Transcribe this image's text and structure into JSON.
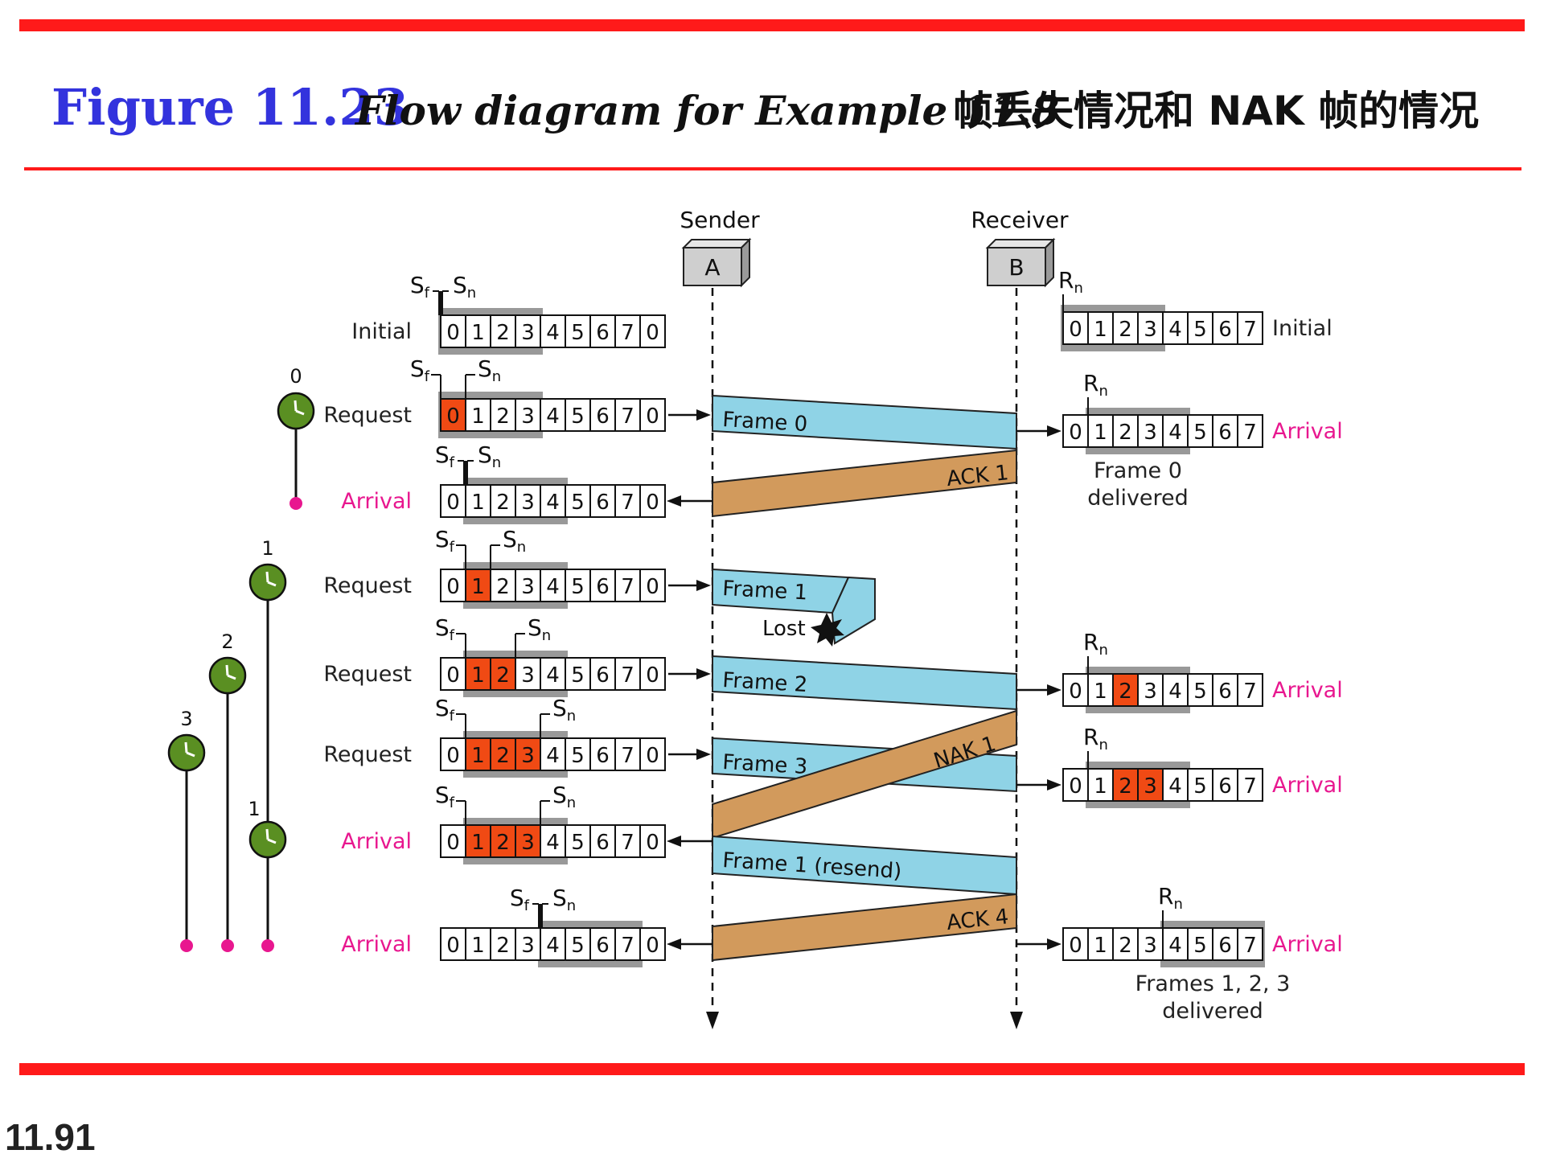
{
  "title": {
    "figure": "Figure 11.23",
    "subtitle": "Flow diagram for Example 11.8",
    "chinese": "帧丢失情况和 NAK 帧的情况"
  },
  "page_number": "11.91",
  "nodes": {
    "sender_label": "Sender",
    "sender_box": "A",
    "receiver_label": "Receiver",
    "receiver_box": "B"
  },
  "colors": {
    "rule": "#ff1a1a",
    "frame": "#8fd3e6",
    "ack": "#d29a5c",
    "highlight": "#f04a14",
    "window": "#999999",
    "timer": "#5a8f22",
    "pink": "#e8178f"
  },
  "var_labels": {
    "sf": "S",
    "sf_sub": "f",
    "sn": "S",
    "sn_sub": "n",
    "rn": "R",
    "rn_sub": "n"
  },
  "sender_rows": [
    {
      "label": "Initial",
      "label_kind": "event",
      "cells": [
        "0",
        "1",
        "2",
        "3",
        "4",
        "5",
        "6",
        "7",
        "0"
      ],
      "highlight": [],
      "window_start": 0,
      "sf": 0,
      "sn": 0
    },
    {
      "label": "Request",
      "label_kind": "event",
      "cells": [
        "0",
        "1",
        "2",
        "3",
        "4",
        "5",
        "6",
        "7",
        "0"
      ],
      "highlight": [
        0
      ],
      "window_start": 0,
      "sf": 0,
      "sn": 1
    },
    {
      "label": "Arrival",
      "label_kind": "arrival",
      "cells": [
        "0",
        "1",
        "2",
        "3",
        "4",
        "5",
        "6",
        "7",
        "0"
      ],
      "highlight": [],
      "window_start": 1,
      "sf": 1,
      "sn": 1
    },
    {
      "label": "Request",
      "label_kind": "event",
      "cells": [
        "0",
        "1",
        "2",
        "3",
        "4",
        "5",
        "6",
        "7",
        "0"
      ],
      "highlight": [
        1
      ],
      "window_start": 1,
      "sf": 1,
      "sn": 2
    },
    {
      "label": "Request",
      "label_kind": "event",
      "cells": [
        "0",
        "1",
        "2",
        "3",
        "4",
        "5",
        "6",
        "7",
        "0"
      ],
      "highlight": [
        1,
        2
      ],
      "window_start": 1,
      "sf": 1,
      "sn": 3
    },
    {
      "label": "Request",
      "label_kind": "event",
      "cells": [
        "0",
        "1",
        "2",
        "3",
        "4",
        "5",
        "6",
        "7",
        "0"
      ],
      "highlight": [
        1,
        2,
        3
      ],
      "window_start": 1,
      "sf": 1,
      "sn": 4
    },
    {
      "label": "Arrival",
      "label_kind": "arrival",
      "cells": [
        "0",
        "1",
        "2",
        "3",
        "4",
        "5",
        "6",
        "7",
        "0"
      ],
      "highlight": [
        1,
        2,
        3
      ],
      "window_start": 1,
      "sf": 1,
      "sn": 4
    },
    {
      "label": "Arrival",
      "label_kind": "arrival",
      "cells": [
        "0",
        "1",
        "2",
        "3",
        "4",
        "5",
        "6",
        "7",
        "0"
      ],
      "highlight": [],
      "window_start": 4,
      "sf": 4,
      "sn": 4
    }
  ],
  "receiver_rows": [
    {
      "label": "Initial",
      "label_kind": "event",
      "cells": [
        "0",
        "1",
        "2",
        "3",
        "4",
        "5",
        "6",
        "7"
      ],
      "highlight": [],
      "window_start": 0,
      "rn": 0,
      "note": []
    },
    {
      "label": "Arrival",
      "label_kind": "arrival",
      "cells": [
        "0",
        "1",
        "2",
        "3",
        "4",
        "5",
        "6",
        "7"
      ],
      "highlight": [],
      "window_start": 1,
      "rn": 1,
      "note": [
        "Frame 0",
        "delivered"
      ]
    },
    {
      "label": "Arrival",
      "label_kind": "arrival",
      "cells": [
        "0",
        "1",
        "2",
        "3",
        "4",
        "5",
        "6",
        "7"
      ],
      "highlight": [
        2
      ],
      "window_start": 1,
      "rn": 1,
      "note": []
    },
    {
      "label": "Arrival",
      "label_kind": "arrival",
      "cells": [
        "0",
        "1",
        "2",
        "3",
        "4",
        "5",
        "6",
        "7"
      ],
      "highlight": [
        2,
        3
      ],
      "window_start": 1,
      "rn": 1,
      "note": []
    },
    {
      "label": "Arrival",
      "label_kind": "arrival",
      "cells": [
        "0",
        "1",
        "2",
        "3",
        "4",
        "5",
        "6",
        "7"
      ],
      "highlight": [],
      "window_start": 4,
      "rn": 4,
      "note": [
        "Frames 1, 2, 3",
        "delivered"
      ]
    }
  ],
  "transmissions": [
    {
      "label": "Frame 0",
      "kind": "frame"
    },
    {
      "label": "ACK 1",
      "kind": "ack"
    },
    {
      "label": "Frame 1",
      "kind": "frame",
      "lost": true
    },
    {
      "label": "Lost",
      "kind": "lost-marker"
    },
    {
      "label": "Frame 2",
      "kind": "frame"
    },
    {
      "label": "NAK 1",
      "kind": "ack"
    },
    {
      "label": "Frame 3",
      "kind": "frame"
    },
    {
      "label": "Frame 1 (resend)",
      "kind": "frame"
    },
    {
      "label": "ACK 4",
      "kind": "ack"
    }
  ],
  "timers": [
    {
      "label": "0"
    },
    {
      "label": "1"
    },
    {
      "label": "2"
    },
    {
      "label": "3"
    },
    {
      "label": "1"
    }
  ]
}
